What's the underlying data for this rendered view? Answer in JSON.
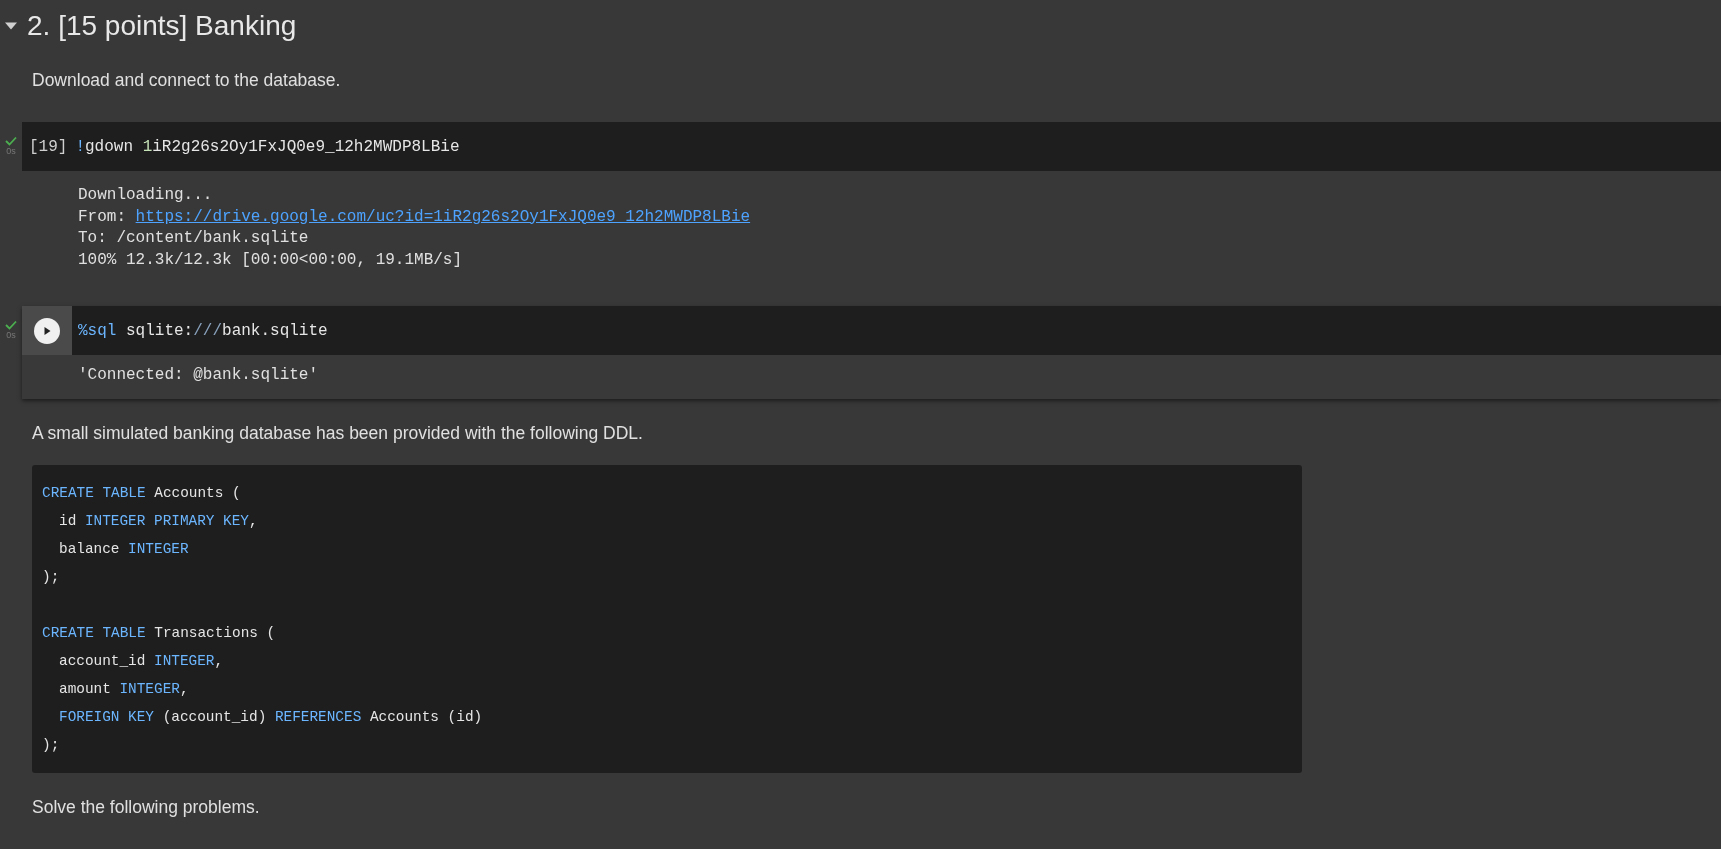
{
  "section": {
    "expanded": true,
    "title": "2. [15 points] Banking"
  },
  "blocks": [
    {
      "kind": "text",
      "text": "Download and connect to the database."
    },
    {
      "kind": "code_cell",
      "succeeded": true,
      "time": "0s",
      "execution_count": "[19]",
      "run_button": false,
      "focused": false,
      "source": [
        {
          "kind": "magic",
          "text": "!"
        },
        {
          "kind": "plain",
          "text": "gdown "
        },
        {
          "kind": "number",
          "text": "1"
        },
        {
          "kind": "plain",
          "text": "iR2g26s2Oy1FxJQ0e9_12h2MWDP8LBie"
        }
      ],
      "output": [
        [
          {
            "kind": "text",
            "text": "Downloading..."
          }
        ],
        [
          {
            "kind": "text",
            "text": "From: "
          },
          {
            "kind": "link",
            "text": "https://drive.google.com/uc?id=1iR2g26s2Oy1FxJQ0e9_12h2MWDP8LBie"
          }
        ],
        [
          {
            "kind": "text",
            "text": "To: /content/bank.sqlite"
          }
        ],
        [
          {
            "kind": "text",
            "text": "100% 12.3k/12.3k [00:00<00:00, 19.1MB/s]"
          }
        ]
      ]
    },
    {
      "kind": "code_cell",
      "succeeded": true,
      "time": "0s",
      "run_button": true,
      "focused": true,
      "source": [
        {
          "kind": "magic",
          "text": "%sql"
        },
        {
          "kind": "plain",
          "text": " sqlite:"
        },
        {
          "kind": "muted",
          "text": "///"
        },
        {
          "kind": "plain",
          "text": "bank.sqlite"
        }
      ],
      "output": [
        [
          {
            "kind": "text",
            "text": "'Connected: @bank.sqlite'"
          }
        ]
      ]
    },
    {
      "kind": "text",
      "text": "A small simulated banking database has been provided with the following DDL."
    },
    {
      "kind": "code_block",
      "statements": [
        {
          "lines": [
            {
              "tokens": [
                {
                  "kind": "keyword",
                  "text": "CREATE TABLE"
                },
                {
                  "kind": "plain",
                  "text": " Accounts ("
                }
              ],
              "children": [
                {
                  "tokens": [
                    {
                      "kind": "plain",
                      "text": "id "
                    },
                    {
                      "kind": "keyword",
                      "text": "INTEGER PRIMARY KEY"
                    },
                    {
                      "kind": "plain",
                      "text": ","
                    }
                  ]
                },
                {
                  "tokens": [
                    {
                      "kind": "plain",
                      "text": "balance "
                    },
                    {
                      "kind": "keyword",
                      "text": "INTEGER"
                    }
                  ]
                }
              ]
            },
            {
              "tokens": [
                {
                  "kind": "plain",
                  "text": ");"
                }
              ]
            }
          ]
        },
        {
          "lines": [
            {
              "tokens": [
                {
                  "kind": "keyword",
                  "text": "CREATE TABLE"
                },
                {
                  "kind": "plain",
                  "text": " Transactions ("
                }
              ],
              "children": [
                {
                  "tokens": [
                    {
                      "kind": "plain",
                      "text": "account_id "
                    },
                    {
                      "kind": "keyword",
                      "text": "INTEGER"
                    },
                    {
                      "kind": "plain",
                      "text": ","
                    }
                  ]
                },
                {
                  "tokens": [
                    {
                      "kind": "plain",
                      "text": "amount "
                    },
                    {
                      "kind": "keyword",
                      "text": "INTEGER"
                    },
                    {
                      "kind": "plain",
                      "text": ","
                    }
                  ]
                },
                {
                  "tokens": [
                    {
                      "kind": "keyword",
                      "text": "FOREIGN KEY"
                    },
                    {
                      "kind": "plain",
                      "text": " (account_id) "
                    },
                    {
                      "kind": "keyword",
                      "text": "REFERENCES"
                    },
                    {
                      "kind": "plain",
                      "text": " Accounts (id)"
                    }
                  ]
                }
              ]
            },
            {
              "tokens": [
                {
                  "kind": "plain",
                  "text": ");"
                }
              ]
            }
          ]
        }
      ]
    },
    {
      "kind": "text",
      "text": "Solve the following problems."
    }
  ]
}
